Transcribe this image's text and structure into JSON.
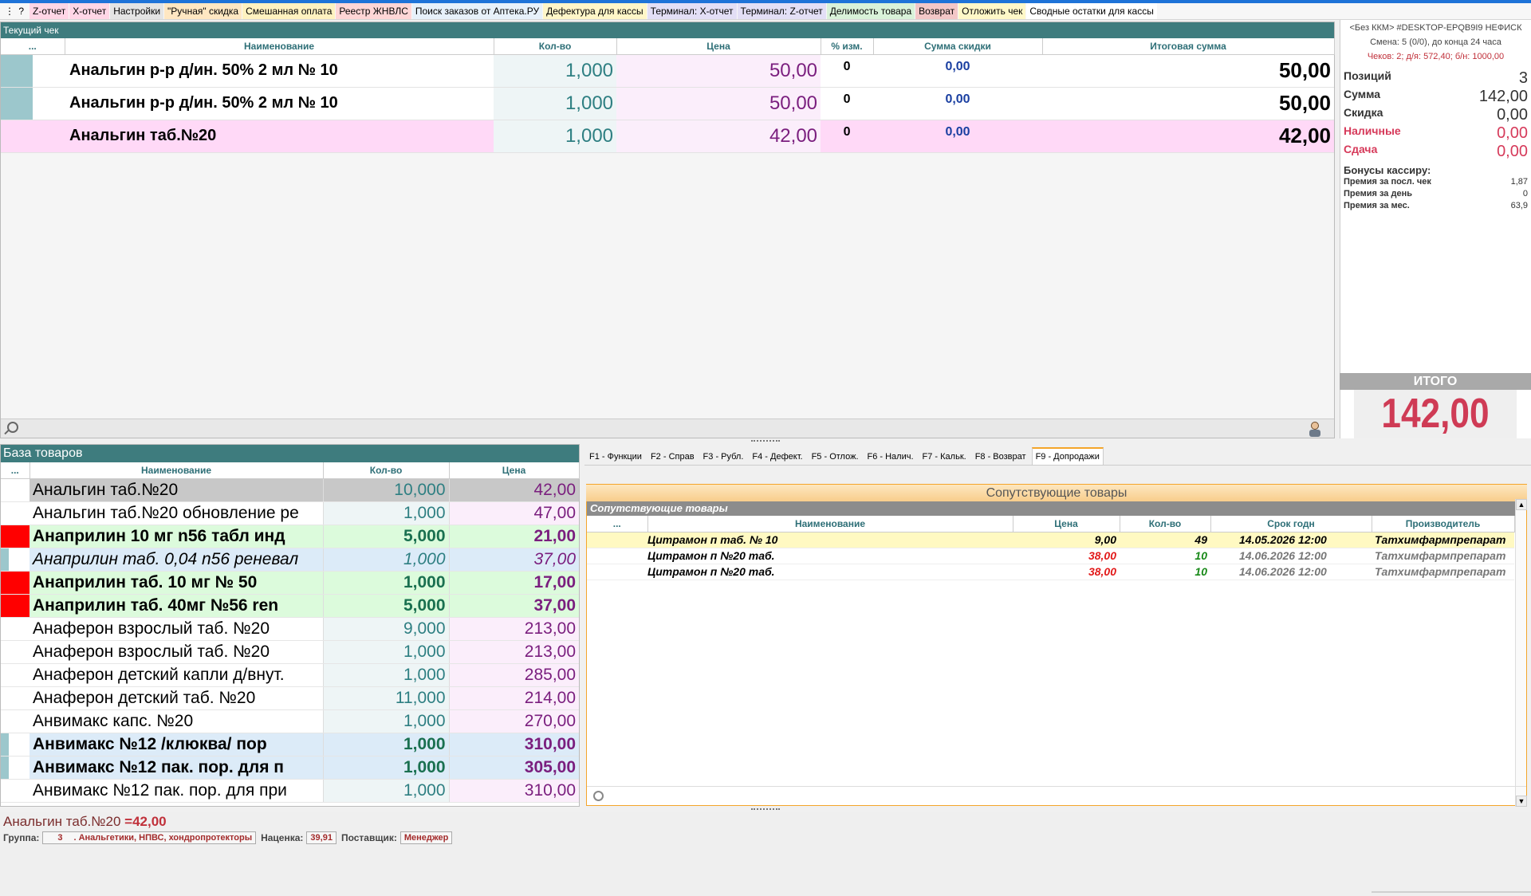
{
  "toolbar": {
    "menu": "⋮ ?",
    "items": [
      {
        "label": "Z-отчет",
        "bg": "#ffd6e6"
      },
      {
        "label": "X-отчет",
        "bg": "#ffd6e6"
      },
      {
        "label": "Настройки",
        "bg": "#e4e4e4"
      },
      {
        "label": "\"Ручная\" скидка",
        "bg": "#ffe7c2"
      },
      {
        "label": "Смешанная оплата",
        "bg": "#fff2c0"
      },
      {
        "label": "Реестр ЖНВЛС",
        "bg": "#ffd6d6"
      },
      {
        "label": "Поиск заказов от Аптека.РУ",
        "bg": "#e7f1fa"
      },
      {
        "label": "Дефектура для кассы",
        "bg": "#fff6c8"
      },
      {
        "label": "Терминал: X-отчет",
        "bg": "#e3dff6"
      },
      {
        "label": "Терминал: Z-отчет",
        "bg": "#e3dff6"
      },
      {
        "label": "Делимость товара",
        "bg": "#d9f2d9"
      },
      {
        "label": "Возврат",
        "bg": "#f3c7c7"
      },
      {
        "label": "Отложить чек",
        "bg": "#fff8c8"
      },
      {
        "label": "Сводные остатки для кассы",
        "bg": "#ffffff"
      }
    ]
  },
  "current_check": {
    "title": "Текущий чек",
    "columns": [
      "...",
      "Наименование",
      "Кол-во",
      "Цена",
      "% изм.",
      "Сумма скидки",
      "Итоговая сумма"
    ],
    "rows": [
      {
        "marker": "#9cc7cc",
        "name": "Анальгин р-р д/ин. 50% 2 мл № 10",
        "qty": "1,000",
        "price": "50,00",
        "pct": "0",
        "discount": "0,00",
        "total": "50,00",
        "bg": "#ffffff"
      },
      {
        "marker": "#9cc7cc",
        "name": "Анальгин р-р д/ин. 50% 2 мл № 10",
        "qty": "1,000",
        "price": "50,00",
        "pct": "0",
        "discount": "0,00",
        "total": "50,00",
        "bg": "#ffffff"
      },
      {
        "marker": "",
        "name": "Анальгин таб.№20",
        "qty": "1,000",
        "price": "42,00",
        "pct": "0",
        "discount": "0,00",
        "total": "42,00",
        "bg": "#ffd9f7"
      }
    ]
  },
  "side": {
    "kkm": "<Без ККМ> #DESKTOP-EPQB9I9 НЕФИСК",
    "shift": "Смена: 5 (0/0), до конца 24 часа",
    "checks": "Чеков: 2; д/я: 572,40; б/н: 1000,00",
    "positions_label": "Позиций",
    "positions": "3",
    "sum_label": "Сумма",
    "sum": "142,00",
    "discount_label": "Скидка",
    "discount": "0,00",
    "cash_label": "Наличные",
    "cash": "0,00",
    "change_label": "Сдача",
    "change": "0,00",
    "bonus_title": "Бонусы кассиру:",
    "bonus": [
      {
        "label": "Премия за посл. чек",
        "value": "1,87"
      },
      {
        "label": "Премия за день",
        "value": "0"
      },
      {
        "label": "Премия за мес.",
        "value": "63,9"
      }
    ],
    "itogo_label": "ИТОГО",
    "itogo": "142,00"
  },
  "base": {
    "title": "База товаров",
    "columns": [
      "...",
      "Наименование",
      "Кол-во",
      "Цена"
    ],
    "rows": [
      {
        "marker": "",
        "name": "Анальгин таб.№20",
        "qty": "10,000",
        "price": "42,00",
        "bg": "#c8c8c8",
        "style": "normal"
      },
      {
        "marker": "",
        "name": "Анальгин таб.№20 обновление ре",
        "qty": "1,000",
        "price": "47,00",
        "bg": "#ffffff",
        "style": "normal"
      },
      {
        "marker": "#ff0000",
        "name": "Анаприлин 10 мг n56 табл инд",
        "qty": "5,000",
        "price": "21,00",
        "bg": "#dcfbdc",
        "style": "bold"
      },
      {
        "marker": "#9cc7cc",
        "name": "Анаприлин таб. 0,04 n56 реневал",
        "qty": "1,000",
        "price": "37,00",
        "bg": "#dcebf8",
        "style": "italic"
      },
      {
        "marker": "#ff0000",
        "name": "Анаприлин таб. 10 мг № 50",
        "qty": "1,000",
        "price": "17,00",
        "bg": "#dcfbdc",
        "style": "bold"
      },
      {
        "marker": "#ff0000",
        "name": "Анаприлин таб. 40мг №56 ren",
        "qty": "5,000",
        "price": "37,00",
        "bg": "#dcfbdc",
        "style": "bold"
      },
      {
        "marker": "",
        "name": "Анаферон взрослый таб. №20",
        "qty": "9,000",
        "price": "213,00",
        "bg": "#ffffff",
        "style": "normal"
      },
      {
        "marker": "",
        "name": "Анаферон взрослый таб. №20",
        "qty": "1,000",
        "price": "213,00",
        "bg": "#ffffff",
        "style": "normal"
      },
      {
        "marker": "",
        "name": "Анаферон детский капли д/внут.",
        "qty": "1,000",
        "price": "285,00",
        "bg": "#ffffff",
        "style": "normal"
      },
      {
        "marker": "",
        "name": "Анаферон детский таб. №20",
        "qty": "11,000",
        "price": "214,00",
        "bg": "#ffffff",
        "style": "normal"
      },
      {
        "marker": "",
        "name": "Анвимакс капс. №20",
        "qty": "1,000",
        "price": "270,00",
        "bg": "#ffffff",
        "style": "normal"
      },
      {
        "marker": "#9cc7cc",
        "name": "Анвимакс №12  /клюква/ пор",
        "qty": "1,000",
        "price": "310,00",
        "bg": "#dcebf8",
        "style": "bold"
      },
      {
        "marker": "#9cc7cc",
        "name": "Анвимакс №12 пак. пор. для п",
        "qty": "1,000",
        "price": "305,00",
        "bg": "#dcebf8",
        "style": "bold"
      },
      {
        "marker": "",
        "name": "Анвимакс №12 пак. пор. для при",
        "qty": "1,000",
        "price": "310,00",
        "bg": "#ffffff",
        "style": "normal"
      }
    ]
  },
  "tabs": [
    {
      "label": "F1 - Функции",
      "active": false
    },
    {
      "label": "F2 - Справ",
      "active": false
    },
    {
      "label": "F3 - Рубл.",
      "active": false
    },
    {
      "label": "F4 - Дефект.",
      "active": false
    },
    {
      "label": "F5 - Отлож.",
      "active": false
    },
    {
      "label": "F6 - Налич.",
      "active": false
    },
    {
      "label": "F7 - Кальк.",
      "active": false
    },
    {
      "label": "F8 - Возврат",
      "active": false
    },
    {
      "label": "F9 - Допродажи",
      "active": true
    }
  ],
  "related": {
    "title": "Сопутствующие товары",
    "subtitle": "Сопутствующие товары",
    "columns": [
      "...",
      "Наименование",
      "Цена",
      "Кол-во",
      "Срок годн",
      "Производитель"
    ],
    "rows": [
      {
        "name": "Цитрамон п таб. № 10",
        "price": "9,00",
        "qty": "49",
        "expiry": "14.05.2026 12:00",
        "maker": "Татхимфармпрепарат",
        "bg": "#fff9c2",
        "price_color": "#000000",
        "qty_color": "#000000",
        "exp_color": "#000000",
        "maker_color": "#000000"
      },
      {
        "name": "Цитрамон п №20 таб.",
        "price": "38,00",
        "qty": "10",
        "expiry": "14.06.2026 12:00",
        "maker": "Татхимфармпрепарат",
        "bg": "#ffffff",
        "price_color": "#e21b1b",
        "qty_color": "#1a8a1a",
        "exp_color": "#777777",
        "maker_color": "#777777"
      },
      {
        "name": "Цитрамон п №20 таб.",
        "price": "38,00",
        "qty": "10",
        "expiry": "14.06.2026 12:00",
        "maker": "Татхимфармпрепарат",
        "bg": "#ffffff",
        "price_color": "#e21b1b",
        "qty_color": "#1a8a1a",
        "exp_color": "#777777",
        "maker_color": "#777777"
      }
    ]
  },
  "status": {
    "product": "Анальгин таб.№20",
    "price": "=42,00",
    "group_label": "Группа:",
    "group_code": "3",
    "group_name": ". Анальгетики, НПВС, хондропротекторы",
    "markup_label": "Наценка:",
    "markup": "39,91",
    "supplier_label": "Поставщик:",
    "supplier": "Менеджер"
  }
}
